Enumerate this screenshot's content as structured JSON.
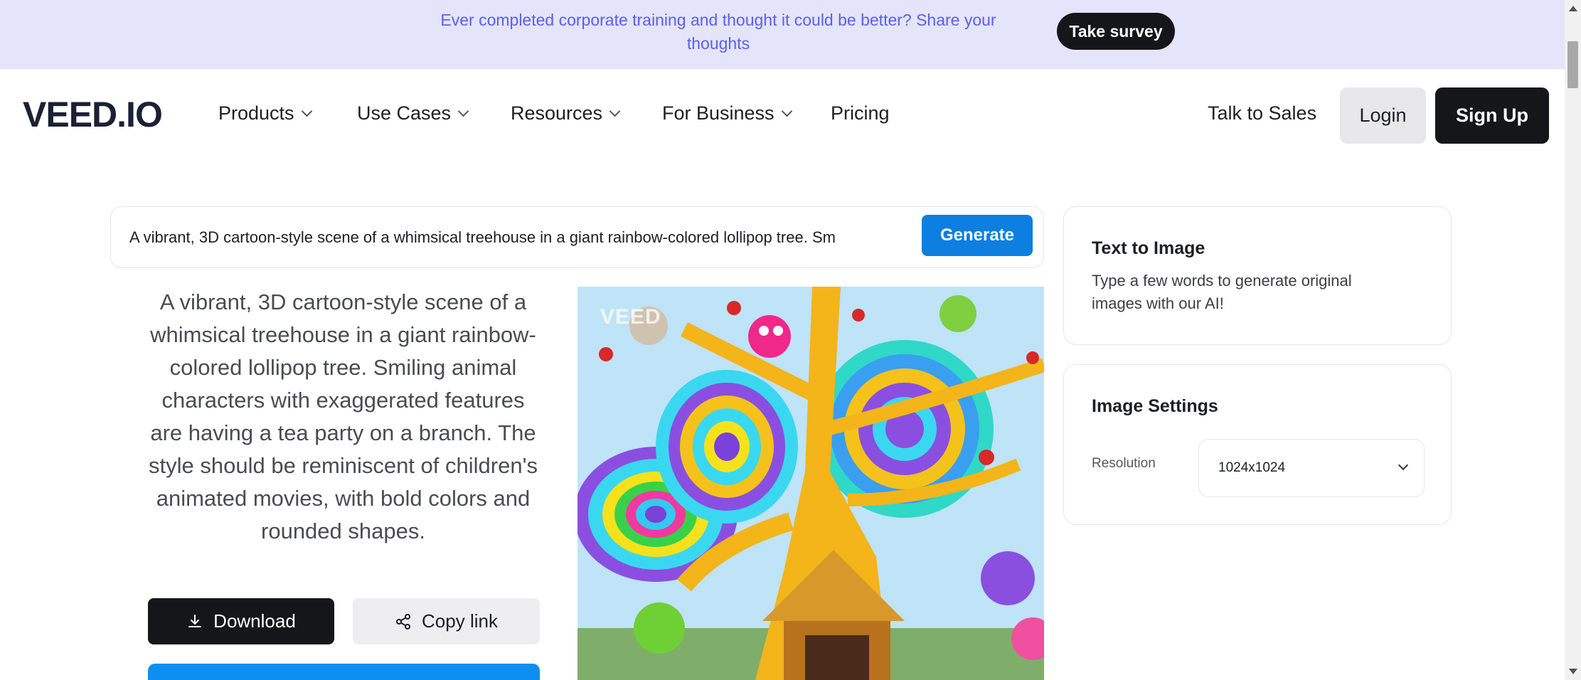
{
  "banner": {
    "text": "Ever completed corporate training and thought it could be better? Share your thoughts",
    "button": "Take survey"
  },
  "nav": {
    "logo": "VEED.IO",
    "items": [
      {
        "label": "Products",
        "dropdown": true
      },
      {
        "label": "Use Cases",
        "dropdown": true
      },
      {
        "label": "Resources",
        "dropdown": true
      },
      {
        "label": "For Business",
        "dropdown": true
      },
      {
        "label": "Pricing",
        "dropdown": false
      }
    ],
    "talk_to_sales": "Talk to Sales",
    "login": "Login",
    "signup": "Sign Up"
  },
  "prompt": {
    "value": "A vibrant, 3D cartoon-style scene of a whimsical treehouse in a giant rainbow-colored lollipop tree. Sm",
    "generate": "Generate"
  },
  "result": {
    "description": "A vibrant, 3D cartoon-style scene of a whimsical treehouse in a giant rainbow-colored lollipop tree. Smiling animal characters with exaggerated features are having a tea party on a branch. The style should be reminiscent of children's animated movies, with bold colors and rounded shapes.",
    "download": "Download",
    "copy_link": "Copy link",
    "watermark": "VEED"
  },
  "sidebar": {
    "text_to_image": {
      "title": "Text to Image",
      "subtitle": "Type a few words to generate original images with our AI!"
    },
    "image_settings": {
      "title": "Image Settings",
      "resolution_label": "Resolution",
      "resolution_value": "1024x1024"
    }
  },
  "colors": {
    "banner_bg": "#e4e4fb",
    "banner_text": "#5a5ff0",
    "primary_blue": "#0c7fe0",
    "dark": "#15161a"
  },
  "icons": {
    "download": "download-icon",
    "share": "share-icon",
    "chevron": "chevron-down-icon"
  }
}
